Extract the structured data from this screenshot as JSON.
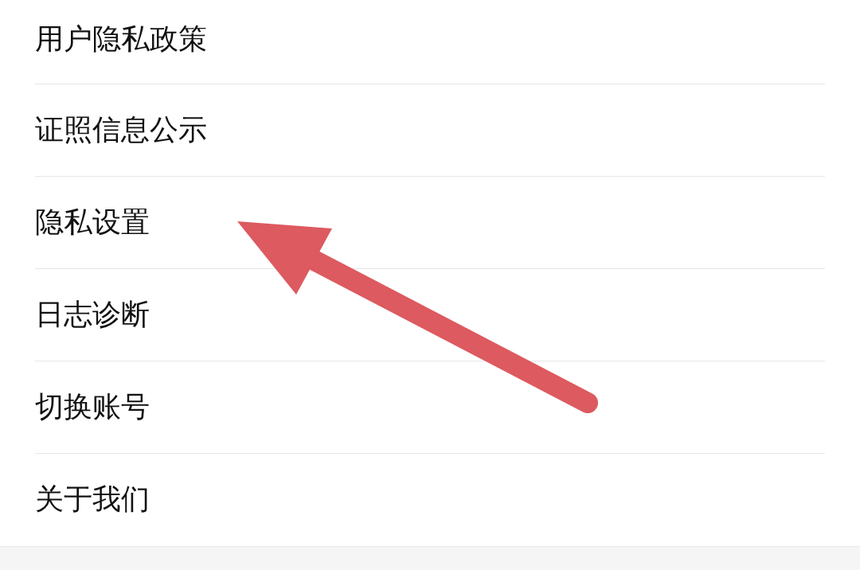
{
  "menu_items": [
    {
      "label": "用户隐私政策"
    },
    {
      "label": "证照信息公示"
    },
    {
      "label": "隐私设置"
    },
    {
      "label": "日志诊断"
    },
    {
      "label": "切换账号"
    },
    {
      "label": "关于我们"
    }
  ]
}
